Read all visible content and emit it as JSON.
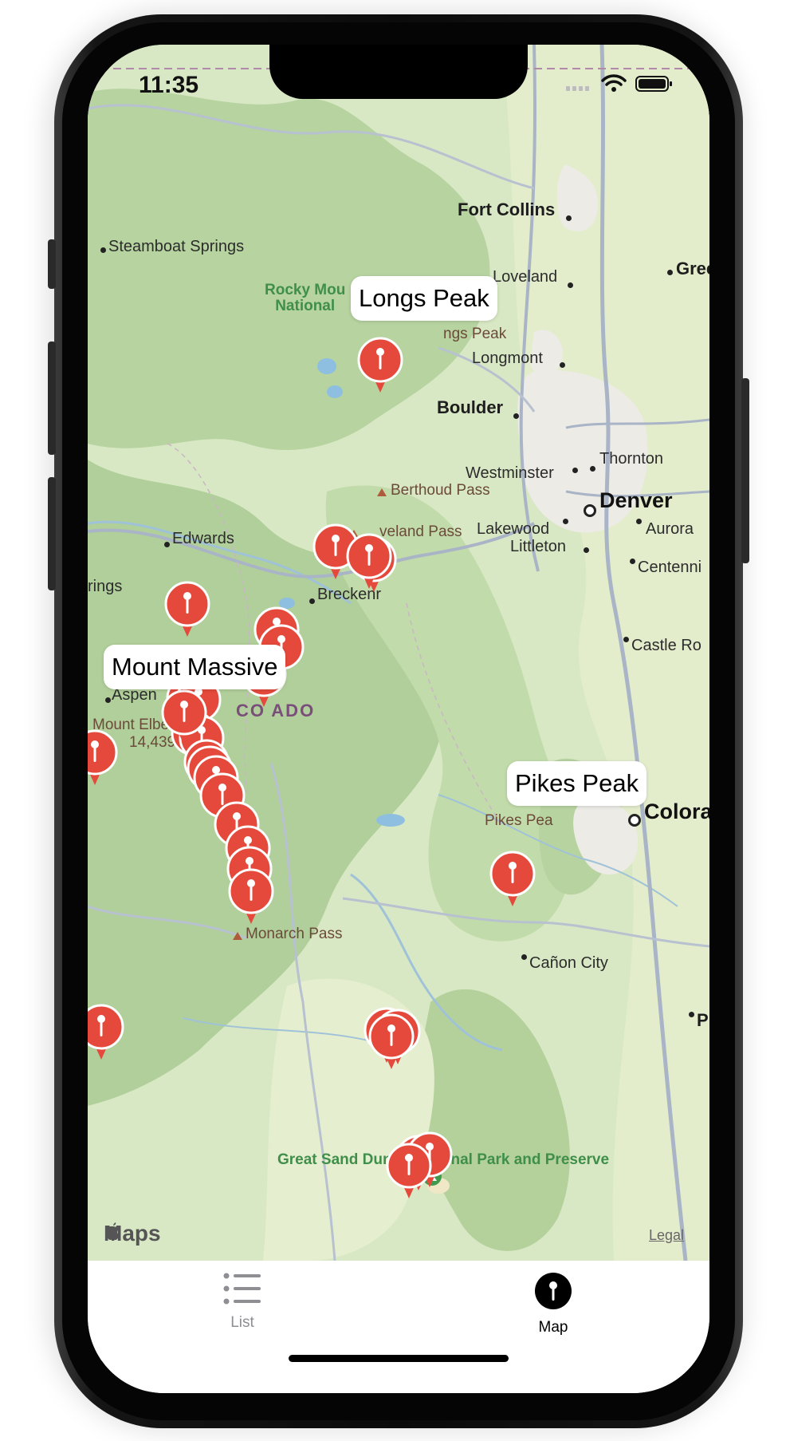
{
  "status_bar": {
    "time": "11:35",
    "icons": [
      "signal-icon",
      "wifi-icon",
      "battery-icon"
    ]
  },
  "map": {
    "cities": [
      "Fort Collins",
      "Steamboat Springs",
      "Loveland",
      "Greeley",
      "Longmont",
      "Boulder",
      "Thornton",
      "Westminster",
      "Denver",
      "Lakewood",
      "Aurora",
      "Littleton",
      "Centennial",
      "Edwards",
      "Breckenridge",
      "Castle Rock",
      "Aspen",
      "Colorado Springs",
      "Cañon City",
      "Pueblo"
    ],
    "partial_labels": {
      "greeley": "Gree",
      "centennial": "Centenni",
      "castle_rock": "Castle Ro",
      "colorado_springs": "Colora",
      "pueblo": "P",
      "glenwood": "rings",
      "loveland_pass": "veland Pass",
      "breckenridge": "Breckenr",
      "longs_peak_peak": "ngs Peak",
      "pikes_peak_peak": "Pikes Pea",
      "mount_elbert": "Mount Elbe",
      "rocky_mountain": "Rocky Mou\nNational",
      "colorado": "CO      ADO"
    },
    "peaks": [
      "Longs Peak",
      "Berthoud Pass",
      "Loveland Pass",
      "Mount Elbert",
      "14,439",
      "Pikes Peak",
      "Monarch Pass"
    ],
    "parks": [
      "Rocky Mountain National Park",
      "Great Sand Dunes National Park and Preserve"
    ],
    "state_label": "COLORADO",
    "callouts": [
      "Longs Peak",
      "Mount Massive",
      "Pikes Peak"
    ],
    "attribution": {
      "logo": "Maps",
      "legal": "Legal"
    },
    "pin_color": "#e5493b"
  },
  "tabs": [
    {
      "label": "List",
      "icon": "list-icon",
      "selected": false
    },
    {
      "label": "Map",
      "icon": "map-pin-icon",
      "selected": true
    }
  ]
}
